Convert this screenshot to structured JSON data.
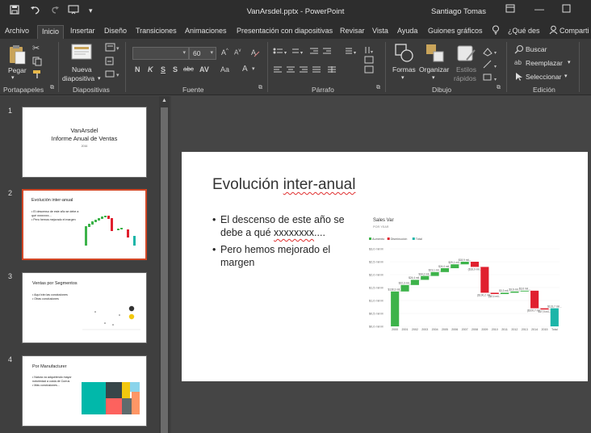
{
  "window": {
    "title": "VanArsdel.pptx  -  PowerPoint",
    "user": "Santiago Tomas"
  },
  "qat": {
    "save_icon": "save-icon",
    "undo_icon": "undo-icon",
    "redo_icon": "redo-icon",
    "present_icon": "present-icon"
  },
  "tabs": [
    {
      "label": "Archivo"
    },
    {
      "label": "Inicio"
    },
    {
      "label": "Insertar"
    },
    {
      "label": "Diseño"
    },
    {
      "label": "Transiciones"
    },
    {
      "label": "Animaciones"
    },
    {
      "label": "Presentación con diapositivas"
    },
    {
      "label": "Revisar"
    },
    {
      "label": "Vista"
    },
    {
      "label": "Ayuda"
    },
    {
      "label": "Guiones gráficos"
    }
  ],
  "tell_me": "¿Qué des",
  "share": "Comparti",
  "ribbon": {
    "groups": {
      "clipboard": "Portapapeles",
      "slides": "Diapositivas",
      "font": "Fuente",
      "paragraph": "Párrafo",
      "drawing": "Dibujo",
      "editing": "Edición"
    },
    "paste": "Pegar",
    "new_slide_line1": "Nueva",
    "new_slide_line2": "diapositiva",
    "font_size": "60",
    "shapes": "Formas",
    "arrange": "Organizar",
    "styles_line1": "Estilos",
    "styles_line2": "rápidos",
    "find": "Buscar",
    "replace": "Reemplazar",
    "select": "Seleccionar",
    "font_buttons": [
      "N",
      "K",
      "S",
      "S",
      "abc",
      "AV",
      "Aa",
      "A"
    ]
  },
  "thumbnails": [
    {
      "num": "1",
      "title_line1": "VanArsdel",
      "title_line2": "Informe Anual de Ventas",
      "subtitle": "2016"
    },
    {
      "num": "2",
      "title": "Evolución inter-anual",
      "b1": "El descenso de este año se debe a qué xxxxxxxx....",
      "b2": "Pero hemos mejorado el margen"
    },
    {
      "num": "3",
      "title": "Ventas por Segmentos",
      "b1": "Aquí irán las conclusiones",
      "b2": "Otras conclusiones"
    },
    {
      "num": "4",
      "title": "Por Manufacturer",
      "b1": "Natura va adquiriendo mayor notoriedad a costa de Currus",
      "b2": "Más conclusiones..."
    }
  ],
  "slide": {
    "title_plain": "Evolución ",
    "title_underlined": "inter-anual",
    "bullet1_plain": "El descenso de este año se debe a qué ",
    "bullet1_underlined": "xxxxxxxx",
    "bullet1_tail": "....",
    "bullet2": "Pero hemos mejorado el margen"
  },
  "chart_data": {
    "type": "bar",
    "title": "Sales Var",
    "subtitle": "POR YEAR",
    "legend": [
      {
        "name": "Aumento",
        "color": "#3db34a"
      },
      {
        "name": "Disminución",
        "color": "#e0202e"
      },
      {
        "name": "Total",
        "color": "#1cb5a8"
      }
    ],
    "legend_position": "top-left",
    "ylim": [
      0,
      3.0
    ],
    "yticks": [
      "$0,0 mil M",
      "$0,5 mil M",
      "$1,0 mil M",
      "$1,5 mil M",
      "$2,0 mil M",
      "$2,5 mil M",
      "$3,0 mil M"
    ],
    "categories": [
      "2000",
      "2001",
      "2002",
      "2003",
      "2004",
      "2005",
      "2006",
      "2007",
      "2008",
      "2009",
      "2010",
      "2011",
      "2012",
      "2013",
      "2014",
      "2015",
      "Total"
    ],
    "bars": [
      {
        "kind": "up",
        "start": 0.0,
        "end": 1.35
      },
      {
        "kind": "up",
        "start": 1.35,
        "end": 1.6
      },
      {
        "kind": "up",
        "start": 1.6,
        "end": 1.8
      },
      {
        "kind": "up",
        "start": 1.8,
        "end": 1.95
      },
      {
        "kind": "up",
        "start": 1.95,
        "end": 2.1
      },
      {
        "kind": "up",
        "start": 2.1,
        "end": 2.25
      },
      {
        "kind": "up",
        "start": 2.25,
        "end": 2.4
      },
      {
        "kind": "up",
        "start": 2.4,
        "end": 2.5
      },
      {
        "kind": "down",
        "start": 2.5,
        "end": 2.3
      },
      {
        "kind": "down",
        "start": 2.3,
        "end": 1.3
      },
      {
        "kind": "down",
        "start": 1.3,
        "end": 1.25
      },
      {
        "kind": "up",
        "start": 1.25,
        "end": 1.3
      },
      {
        "kind": "up",
        "start": 1.3,
        "end": 1.35
      },
      {
        "kind": "up",
        "start": 1.35,
        "end": 1.38
      },
      {
        "kind": "down",
        "start": 1.38,
        "end": 0.7
      },
      {
        "kind": "down",
        "start": 0.7,
        "end": 0.65
      },
      {
        "kind": "total",
        "start": 0.0,
        "end": 0.7
      }
    ],
    "data_labels": [
      "$138,3 mil...",
      "$22,3 mil...",
      "$24,4 mil...",
      "$34,2 mil...",
      "$23,1 mil...",
      "$24,0 mil...",
      "$29,1 mil...",
      "$18,9 mil...",
      "($18,0 mil...",
      "($100,2 mil...",
      "($2,4 mil...",
      "$3,3 mil...",
      "$3,6 mil...",
      "$3,6 mil...",
      "($100,7 mil...",
      "$17,9 mil...",
      "$133,7 mil..."
    ]
  }
}
